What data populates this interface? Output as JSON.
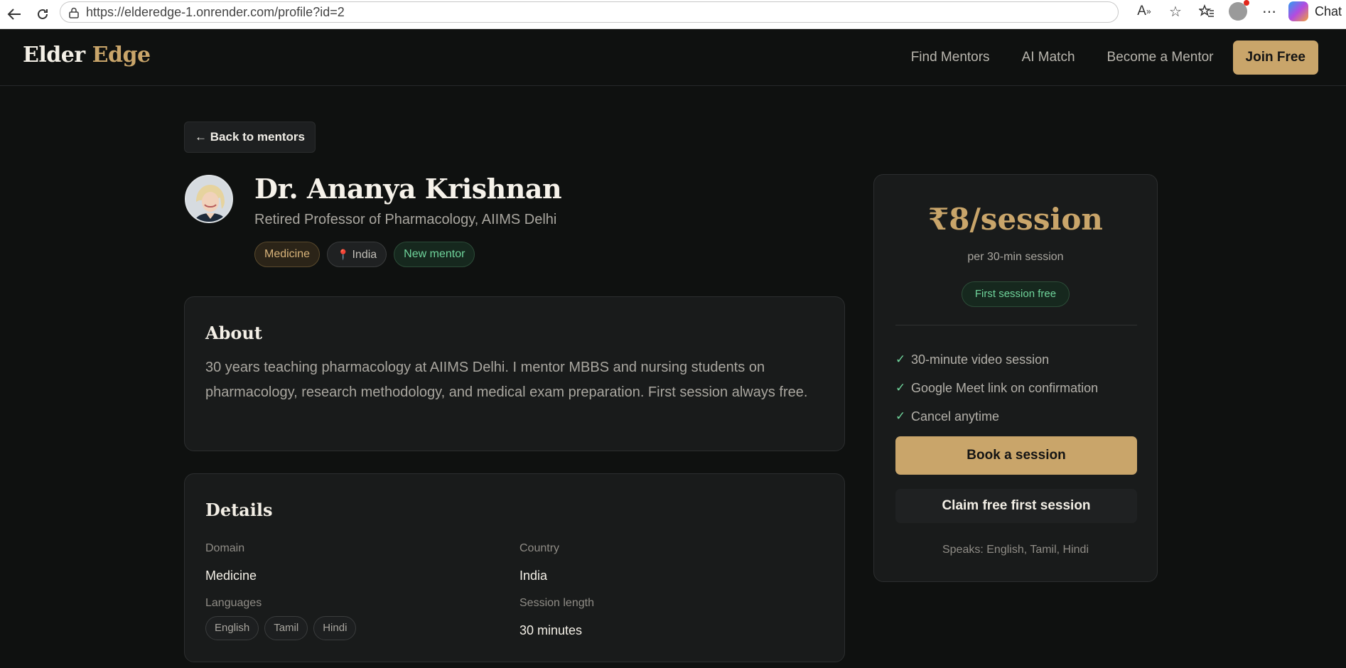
{
  "browser": {
    "url": "https://elderedge-1.onrender.com/profile?id=2",
    "chat_label": "Chat"
  },
  "site": {
    "logo_part1": "Elder",
    "logo_part2": "Edge",
    "nav": [
      "Find Mentors",
      "AI Match",
      "Become a Mentor"
    ],
    "join_label": "Join Free"
  },
  "back_label": "← Back to mentors",
  "profile": {
    "name": "Dr. Ananya Krishnan",
    "title": "Retired Professor of Pharmacology, AIIMS Delhi",
    "tags": {
      "domain": "Medicine",
      "country": "India",
      "status": "New mentor"
    }
  },
  "about": {
    "heading": "About",
    "text": "30 years teaching pharmacology at AIIMS Delhi. I mentor MBBS and nursing students on pharmacology, research methodology, and medical exam preparation. First session always free."
  },
  "details": {
    "heading": "Details",
    "domain_label": "Domain",
    "domain_value": "Medicine",
    "country_label": "Country",
    "country_value": "India",
    "languages_label": "Languages",
    "languages": [
      "English",
      "Tamil",
      "Hindi"
    ],
    "session_label": "Session length",
    "session_value": "30 minutes"
  },
  "pricing": {
    "price": "₹8/session",
    "sub": "per 30-min session",
    "badge": "First session free",
    "features": [
      "30-minute video session",
      "Google Meet link on confirmation",
      "Cancel anytime"
    ],
    "book_label": "Book a session",
    "claim_label": "Claim free first session",
    "speaks": "Speaks: English, Tamil, Hindi"
  },
  "colors": {
    "accent": "#c9a56a",
    "background": "#0f1110",
    "card": "#191b1b",
    "success": "#6fd49b"
  }
}
